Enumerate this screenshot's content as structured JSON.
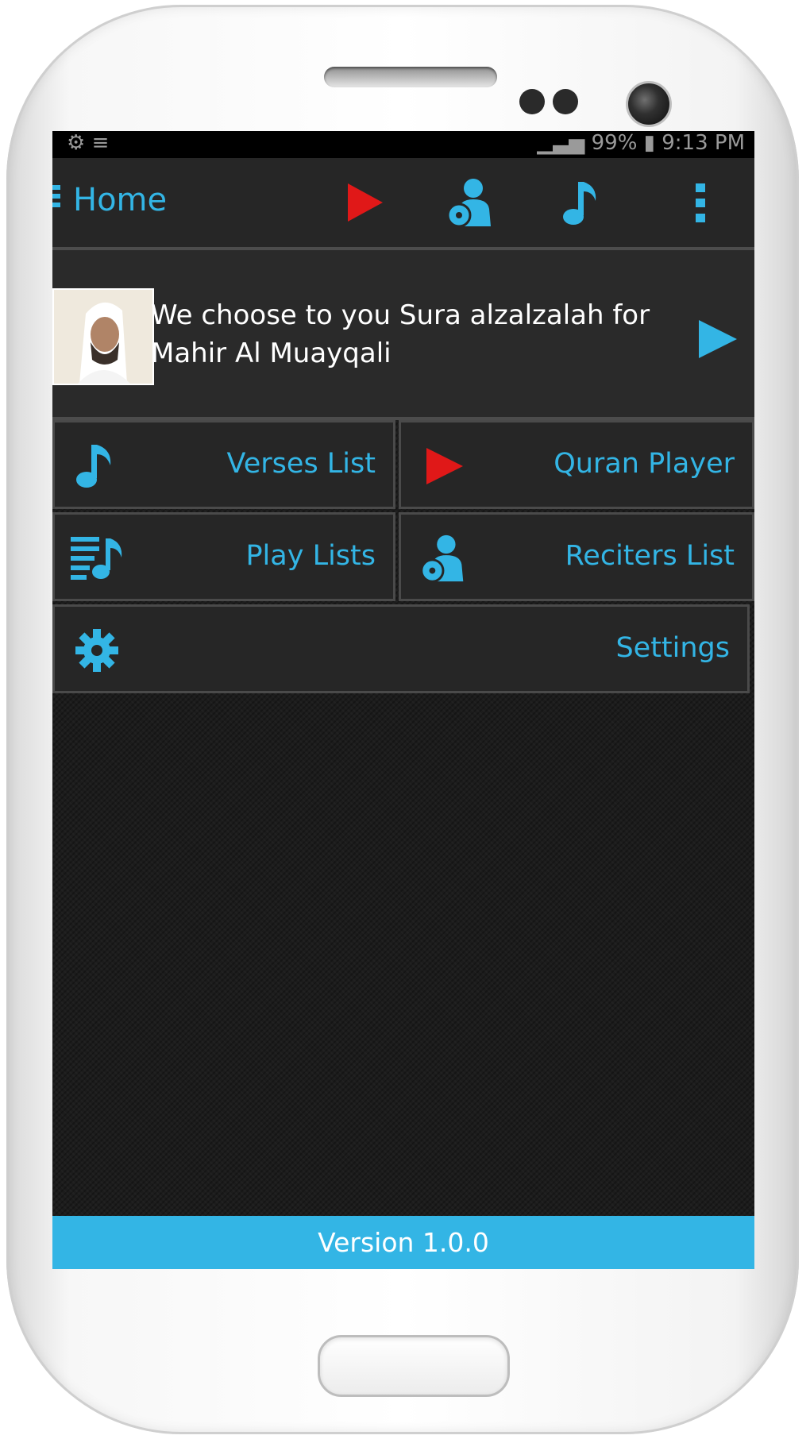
{
  "status_bar": {
    "left_text": "⚙  ≡",
    "right_text": "▁▃▅ 99% ▮  9:13 PM"
  },
  "action_bar": {
    "title": "Home",
    "icons": [
      "play-icon",
      "reciter-icon",
      "music-note-icon",
      "overflow-menu-icon"
    ]
  },
  "banner": {
    "text": "We choose to you Sura alzalzalah for Mahir Al Muayqali"
  },
  "menu": {
    "verses_list": "Verses List",
    "quran_player": "Quran Player",
    "play_lists": "Play Lists",
    "reciters_list": "Reciters List",
    "settings": "Settings"
  },
  "footer": {
    "version": "Version 1.0.0"
  },
  "colors": {
    "accent": "#33b5e5",
    "play_red": "#e01818",
    "background": "#1c1c1c"
  }
}
